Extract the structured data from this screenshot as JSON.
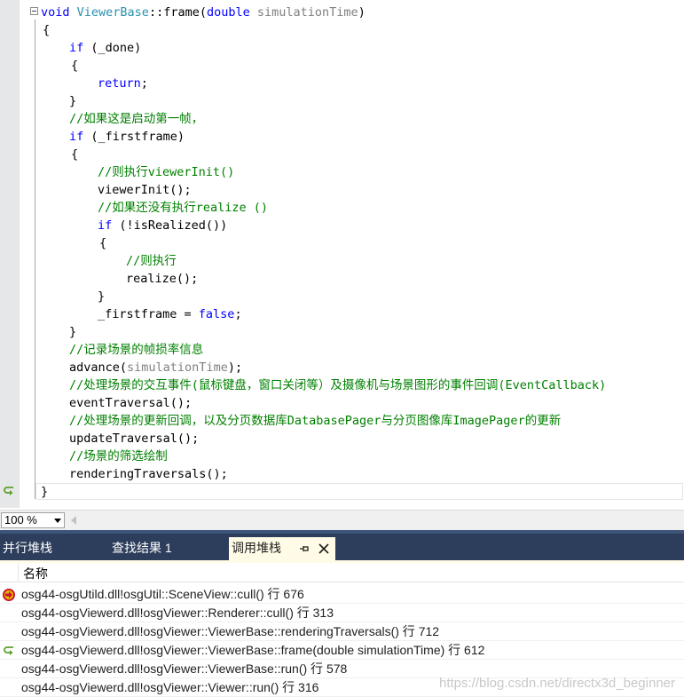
{
  "editor": {
    "lines": [
      {
        "k": "sig"
      },
      {
        "t": "{"
      },
      {
        "t": "if (_done)",
        "kw": "if"
      },
      {
        "t": "{"
      },
      {
        "t": "return;",
        "kw": "return"
      },
      {
        "t": "}"
      },
      {
        "t": "//如果这是启动第一帧，",
        "cm": true
      },
      {
        "t": "if (_firstframe)",
        "kw": "if"
      },
      {
        "t": "{"
      },
      {
        "t": "//则执行viewerInit()",
        "cm": true
      },
      {
        "t": "viewerInit();"
      },
      {
        "t": "//如果还没有执行realize ()",
        "cm": true
      },
      {
        "t": "if (!isRealized())",
        "kw": "if"
      },
      {
        "t": "{"
      },
      {
        "t": "//则执行",
        "cm": true
      },
      {
        "t": "realize();"
      },
      {
        "t": "}"
      },
      {
        "t": "_firstframe = false;",
        "kw2": "false"
      },
      {
        "t": "}"
      },
      {
        "t": "//记录场景的帧损率信息",
        "cm": true
      },
      {
        "t": "advance(simulationTime);",
        "param": "simulationTime"
      },
      {
        "t": "//处理场景的交互事件(鼠标键盘，窗口关闭等）及摄像机与场景图形的事件回调(EventCallback)",
        "cm": true
      },
      {
        "t": "eventTraversal();"
      },
      {
        "t": "//处理场景的更新回调，以及分页数据库DatabasePager与分页图像库ImagePager的更新",
        "cm": true
      },
      {
        "t": "updateTraversal();"
      },
      {
        "t": "//场景的筛选绘制",
        "cm": true
      },
      {
        "t": "renderingTraversals();"
      },
      {
        "t": "}"
      }
    ],
    "signature": {
      "kw_void": "void",
      "class_name": "ViewerBase",
      "sep": "::",
      "func": "frame(",
      "kw_double": "double",
      "param": "simulationTime",
      "close": ")"
    }
  },
  "zoom": {
    "value": "100 %"
  },
  "tabs": {
    "parallel_stacks": "并行堆栈",
    "find_results": "查找结果 1",
    "call_stack": "调用堆栈"
  },
  "call_stack": {
    "header": "名称",
    "rows": [
      {
        "text": "osg44-osgUtild.dll!osgUtil::SceneView::cull() 行 676",
        "icon": "current-frame-icon"
      },
      {
        "text": "osg44-osgViewerd.dll!osgViewer::Renderer::cull() 行 313",
        "icon": ""
      },
      {
        "text": "osg44-osgViewerd.dll!osgViewer::ViewerBase::renderingTraversals() 行 712",
        "icon": ""
      },
      {
        "text": "osg44-osgViewerd.dll!osgViewer::ViewerBase::frame(double simulationTime) 行 612",
        "icon": "return-arrow-icon"
      },
      {
        "text": "osg44-osgViewerd.dll!osgViewer::ViewerBase::run() 行 578",
        "icon": ""
      },
      {
        "text": "osg44-osgViewerd.dll!osgViewer::Viewer::run() 行 316",
        "icon": ""
      }
    ]
  },
  "watermark": "https://blog.csdn.net/directx3d_beginner"
}
